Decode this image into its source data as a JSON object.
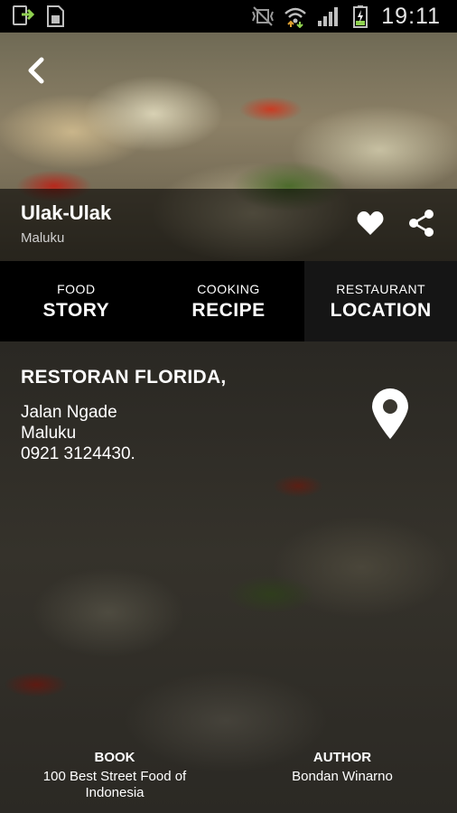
{
  "status_bar": {
    "time": "19:11",
    "icons": [
      "download-complete-icon",
      "sd-card-icon",
      "vibrate-mute-icon",
      "wifi-icon",
      "signal-icon",
      "battery-charging-icon"
    ]
  },
  "dish": {
    "name": "Ulak-Ulak",
    "region": "Maluku"
  },
  "tabs": [
    {
      "small": "FOOD",
      "big": "STORY"
    },
    {
      "small": "COOKING",
      "big": "RECIPE"
    },
    {
      "small": "RESTAURANT",
      "big": "LOCATION"
    }
  ],
  "active_tab": 2,
  "restaurant": {
    "name": "RESTORAN FLORIDA,",
    "address_lines": [
      "Jalan Ngade",
      "Maluku",
      "0921 3124430."
    ]
  },
  "footer": {
    "book_label": "BOOK",
    "book_value": "100 Best Street Food of Indonesia",
    "author_label": "AUTHOR",
    "author_value": "Bondan Winarno"
  },
  "colors": {
    "tab_bg": "#000000",
    "active_tab_bg": "#151515",
    "overlay": "rgba(0,0,0,0.58)",
    "battery_green": "#8fd14f"
  }
}
